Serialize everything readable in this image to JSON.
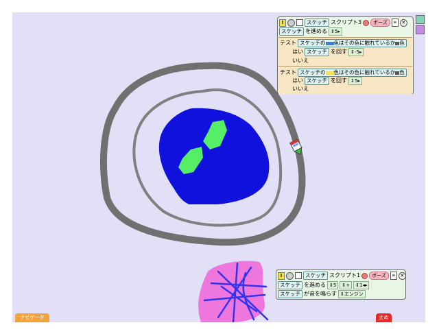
{
  "navigator_button": "ナビゲータ",
  "stop_button": "止め",
  "script_top": {
    "header": {
      "sketch_label": "スケッチ",
      "script_name": "スクリプト3",
      "pause_label": "ポーズ"
    },
    "forward_row": {
      "sketch": "スケッチ",
      "verb": "を進める",
      "value": "5"
    },
    "test1": {
      "test_label": "テスト",
      "condition_prefix": "スケッチの",
      "condition_text": "色はその色に触れているか",
      "color_suffix": "色",
      "swatch_color": "#3c7ddc",
      "yes_label": "はい",
      "yes_sketch": "スケッチ",
      "yes_verb": "を回す",
      "yes_value": "-5",
      "no_label": "いいえ"
    },
    "test2": {
      "test_label": "テスト",
      "condition_prefix": "スケッチの",
      "condition_text": "色はその色に触れているか",
      "color_suffix": "色",
      "swatch_color": "#f2e25a",
      "yes_label": "はい",
      "yes_sketch": "スケッチ",
      "yes_verb": "を回す",
      "yes_value": "5",
      "no_label": "いいえ"
    }
  },
  "script_bottom": {
    "header": {
      "sketch_label": "スケッチ",
      "script_name": "スクリプト1",
      "pause_label": "ポーズ"
    },
    "forward_row": {
      "sketch": "スケッチ",
      "verb": "を進める",
      "value_a": "5",
      "op": "+",
      "value_b": "1"
    },
    "sound_row": {
      "sketch": "スケッチ",
      "verb": "が音を鳴らす",
      "sound": "エンジン"
    }
  },
  "colors": {
    "world_bg": "#e2e0f6",
    "track": "#707070",
    "lake": "#1111dd",
    "island": "#55ee66",
    "pink": "#ee77dd",
    "scribble": "#3333ee"
  }
}
